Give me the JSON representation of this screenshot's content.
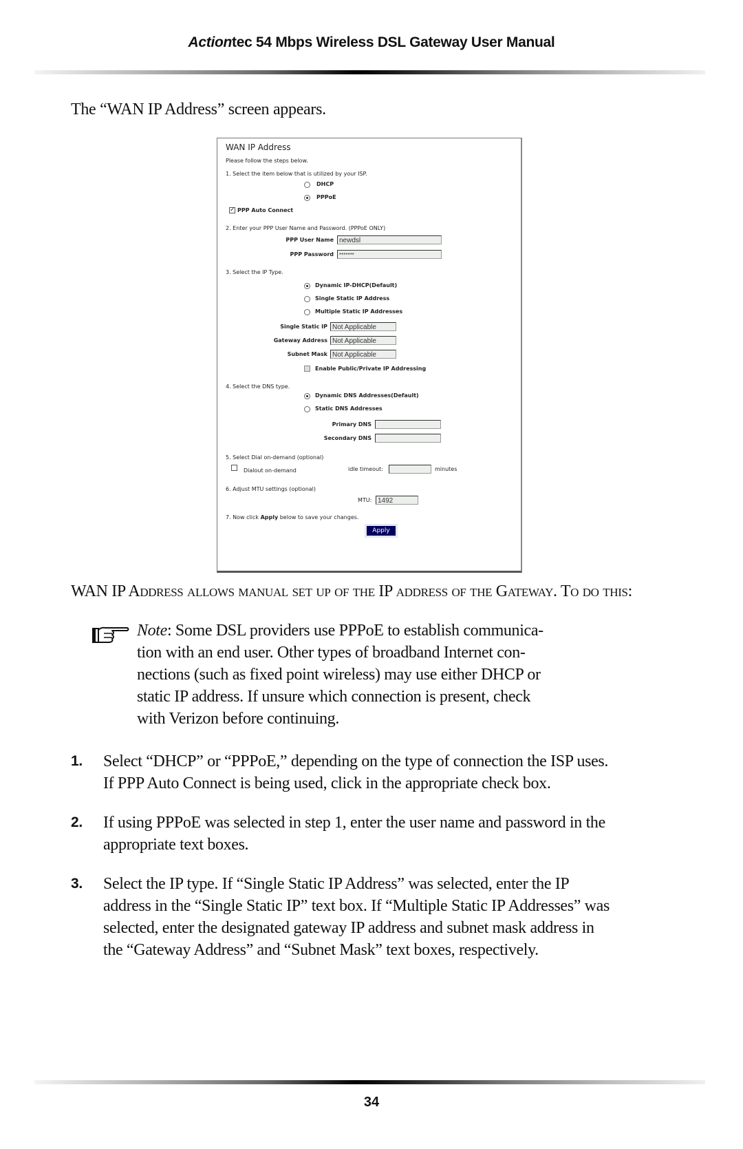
{
  "header": {
    "title_italic": "Action",
    "title_rest": "tec 54 Mbps Wireless DSL Gateway User Manual"
  },
  "intro": "The “WAN IP Address” screen appears.",
  "screenshot": {
    "title": "WAN IP Address",
    "instructions": "Please follow the steps below.",
    "step1": "1. Select the item below that is utilized by your ISP.",
    "isp_options": [
      {
        "label": "DHCP",
        "selected": false
      },
      {
        "label": "PPPoE",
        "selected": true
      }
    ],
    "auto_connect": {
      "label": "PPP Auto Connect",
      "checked": true
    },
    "step2": "2. Enter your PPP User Name and Password. (PPPoE ONLY)",
    "username_label": "PPP User Name",
    "username_value": "newdsl",
    "password_label": "PPP Password",
    "password_value": "*******",
    "step3": "3. Select the IP Type.",
    "ip_type_options": [
      {
        "label": "Dynamic IP-DHCP(Default)",
        "selected": true
      },
      {
        "label": "Single Static IP Address",
        "selected": false
      },
      {
        "label": "Multiple Static IP Addresses",
        "selected": false
      }
    ],
    "single_static_ip_label": "Single Static IP",
    "single_static_ip_value": "Not Applicable",
    "gateway_label": "Gateway Address",
    "gateway_value": "Not Applicable",
    "subnet_label": "Subnet Mask",
    "subnet_value": "Not Applicable",
    "public_private": {
      "label": "Enable Public/Private IP Addressing",
      "checked": false
    },
    "step4": "4. Select the DNS type.",
    "dns_options": [
      {
        "label": "Dynamic DNS Addresses(Default)",
        "selected": true
      },
      {
        "label": "Static DNS Addresses",
        "selected": false
      }
    ],
    "primary_dns_label": "Primary DNS",
    "primary_dns_value": "",
    "secondary_dns_label": "Secondary DNS",
    "secondary_dns_value": "",
    "step5": "5. Select Dial on-demand (optional)",
    "dialout": {
      "label": "Dialout on-demand",
      "checked": false
    },
    "idle_timeout_label": "idle timeout:",
    "idle_timeout_value": "",
    "minutes_label": "minutes",
    "step6": "6. Adjust MTU settings (optional)",
    "mtu_label": "MTU:",
    "mtu_value": "1492",
    "step7_prefix": "7. Now click ",
    "step7_bold": "Apply",
    "step7_suffix": " below to save your changes.",
    "apply_label": "Apply",
    "apply_color": "#00005e"
  },
  "body_text": "WAN IP Address allows manual set up of the IP address of the Gateway. To do this:",
  "note": {
    "icon": "pointing-hand-icon",
    "label": "Note",
    "lines": [
      ": Some DSL providers use PPPoE to establish communica-",
      "tion with an end user. Other types of broadband Internet con-",
      "nections (such as fixed point wireless) may use either DHCP or",
      "static IP address. If unsure which connection is present, check",
      "with Verizon before continuing."
    ]
  },
  "steps": [
    {
      "num": "1.",
      "lines": [
        "Select “DHCP” or “PPPoE,” depending on the type of connection the ISP uses.",
        "If PPP Auto Connect is being used, click in the appropriate check box."
      ]
    },
    {
      "num": "2.",
      "lines": [
        "If using PPPoE was selected in step 1, enter the user name and password in the",
        "appropriate text boxes."
      ]
    },
    {
      "num": "3.",
      "lines": [
        "Select the IP type. If “Single Static IP Address” was selected, enter the IP",
        "address in the “Single Static IP” text box. If “Multiple Static IP Addresses” was",
        "selected, enter the designated gateway IP address and subnet mask address in",
        "the “Gateway Address” and “Subnet Mask” text boxes, respectively."
      ]
    }
  ],
  "page_number": "34"
}
